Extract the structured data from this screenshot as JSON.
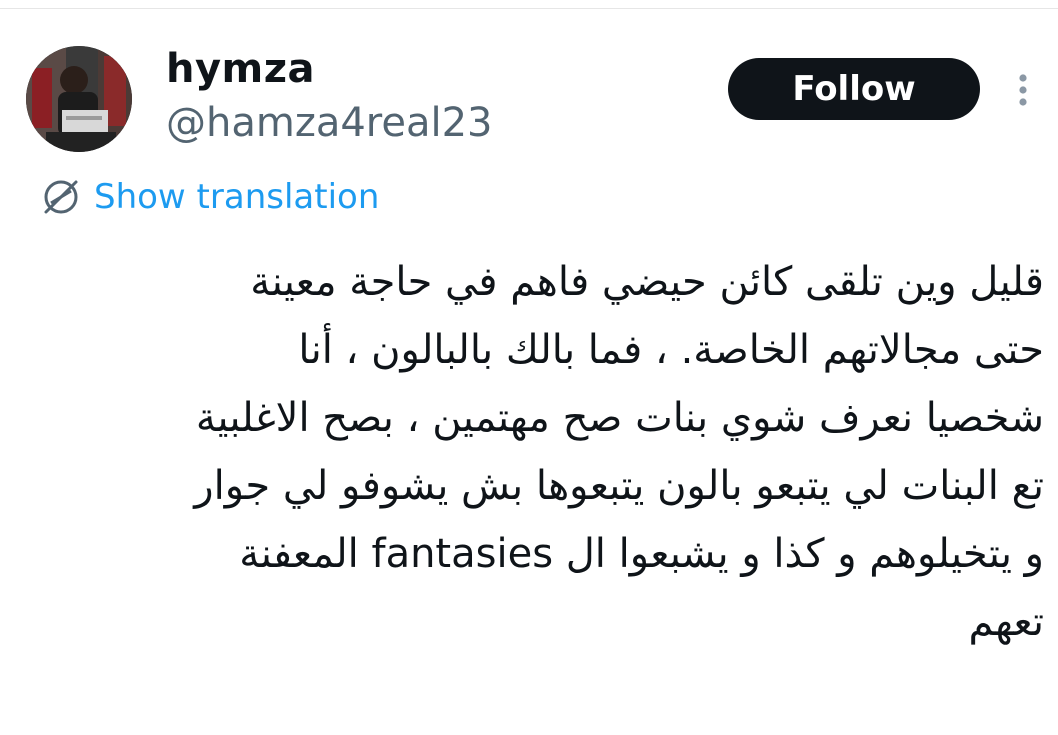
{
  "author": {
    "display_name": "hymza",
    "handle": "@hamza4real23"
  },
  "actions": {
    "follow_label": "Follow",
    "more_icon": "more-vertical-icon"
  },
  "translation": {
    "label": "Show translation",
    "icon": "globe-icon"
  },
  "tweet": {
    "lines": [
      "قليل وين تلقى كائن حيضي فاهم في حاجة معينة",
      "حتى مجالاتهم الخاصة. ، فما بالك بالبالون ، أنا",
      "شخصيا نعرف شوي بنات صح مهتمين ، بصح الاغلبية",
      "تع البنات لي يتبعو بالون يتبعوها بش يشوفو لي جوار",
      "و يتخيلوهم و كذا و يشبعوا ال fantasies  المعفنة",
      "تعهم"
    ]
  },
  "colors": {
    "text_primary": "#0f1419",
    "text_secondary": "#536471",
    "link": "#1d9bf0",
    "button_bg": "#0f1419",
    "button_text": "#ffffff"
  }
}
